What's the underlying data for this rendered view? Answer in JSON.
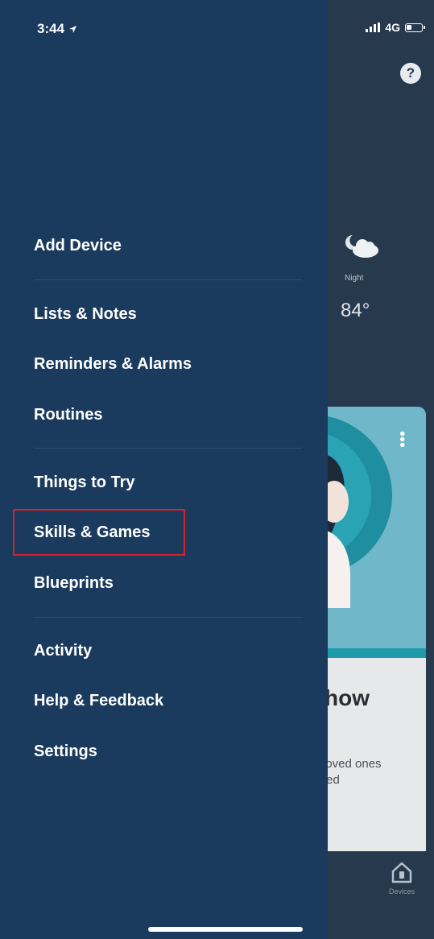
{
  "status_bar": {
    "time": "3:44",
    "network": "4G"
  },
  "drawer": {
    "groups": [
      {
        "items": [
          {
            "label": "Add Device"
          }
        ]
      },
      {
        "items": [
          {
            "label": "Lists & Notes"
          },
          {
            "label": "Reminders & Alarms"
          },
          {
            "label": "Routines"
          }
        ]
      },
      {
        "items": [
          {
            "label": "Things to Try"
          },
          {
            "label": "Skills & Games",
            "highlighted": true
          },
          {
            "label": "Blueprints"
          }
        ]
      },
      {
        "items": [
          {
            "label": "Activity"
          },
          {
            "label": "Help & Feedback"
          },
          {
            "label": "Settings"
          }
        ]
      }
    ]
  },
  "background": {
    "help_icon": "?",
    "weather": {
      "label": "Night",
      "temperature": "84°",
      "icon": "partly-cloudy-night-icon"
    },
    "card": {
      "heading": "how",
      "text_line1": "loved ones",
      "text_line2": "ted"
    },
    "bottom_tab": {
      "label": "Devices",
      "icon": "devices-icon"
    }
  },
  "colors": {
    "drawer_bg": "#1a3b5d",
    "app_bg": "#26394d",
    "highlight": "#d6242b",
    "card_accent": "#6fb7c9"
  }
}
